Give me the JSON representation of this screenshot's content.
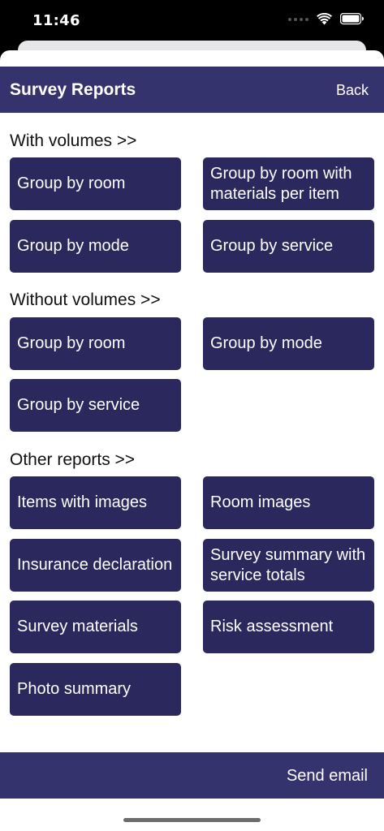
{
  "status_bar": {
    "time": "11:46"
  },
  "nav": {
    "title": "Survey Reports",
    "back_label": "Back"
  },
  "sections": {
    "with_volumes": {
      "header": "With volumes >>",
      "buttons": [
        "Group by room",
        "Group by room with materials per item",
        "Group by mode",
        "Group by service"
      ]
    },
    "without_volumes": {
      "header": "Without volumes >>",
      "buttons": [
        "Group by room",
        "Group by mode",
        "Group by service"
      ]
    },
    "other_reports": {
      "header": "Other reports >>",
      "buttons": [
        "Items with images",
        "Room images",
        "Insurance declaration",
        "Survey summary with service totals",
        "Survey materials",
        "Risk assessment",
        "Photo summary"
      ]
    }
  },
  "footer": {
    "send_email_label": "Send email"
  },
  "colors": {
    "nav_background": "#34336d",
    "button_background": "#2b285e"
  },
  "icons": [
    "signal-icon",
    "wifi-icon",
    "battery-icon"
  ]
}
